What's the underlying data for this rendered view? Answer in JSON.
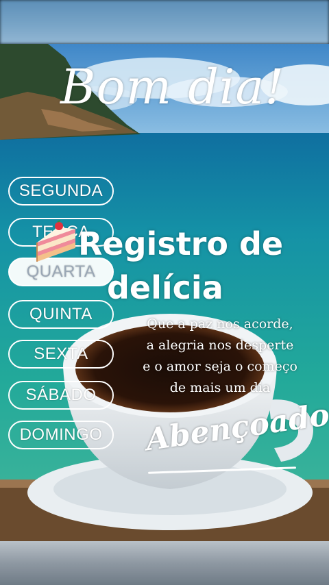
{
  "greeting": "Bom dia!",
  "weekdays": [
    "SEGUNDA",
    "TERÇA",
    "QUARTA",
    "QUINTA",
    "SEXTA",
    "SÁBADO",
    "DOMINGO"
  ],
  "selected_day": "QUARTA",
  "caption": {
    "emoji_icon": "cake-slice-icon",
    "line1": "Registro de",
    "line2": "delícia"
  },
  "quote": {
    "line1": "Que a paz nos acorde,",
    "line2": "a alegria nos desperte",
    "line3": "e o amor seja o começo",
    "line4": "de mais um dia"
  },
  "blessing": "Abençoado!",
  "colors": {
    "sea": "#1aa39b",
    "sky": "#4f93cf",
    "text": "#ffffff",
    "active_day_text": "#9aa7b5"
  }
}
